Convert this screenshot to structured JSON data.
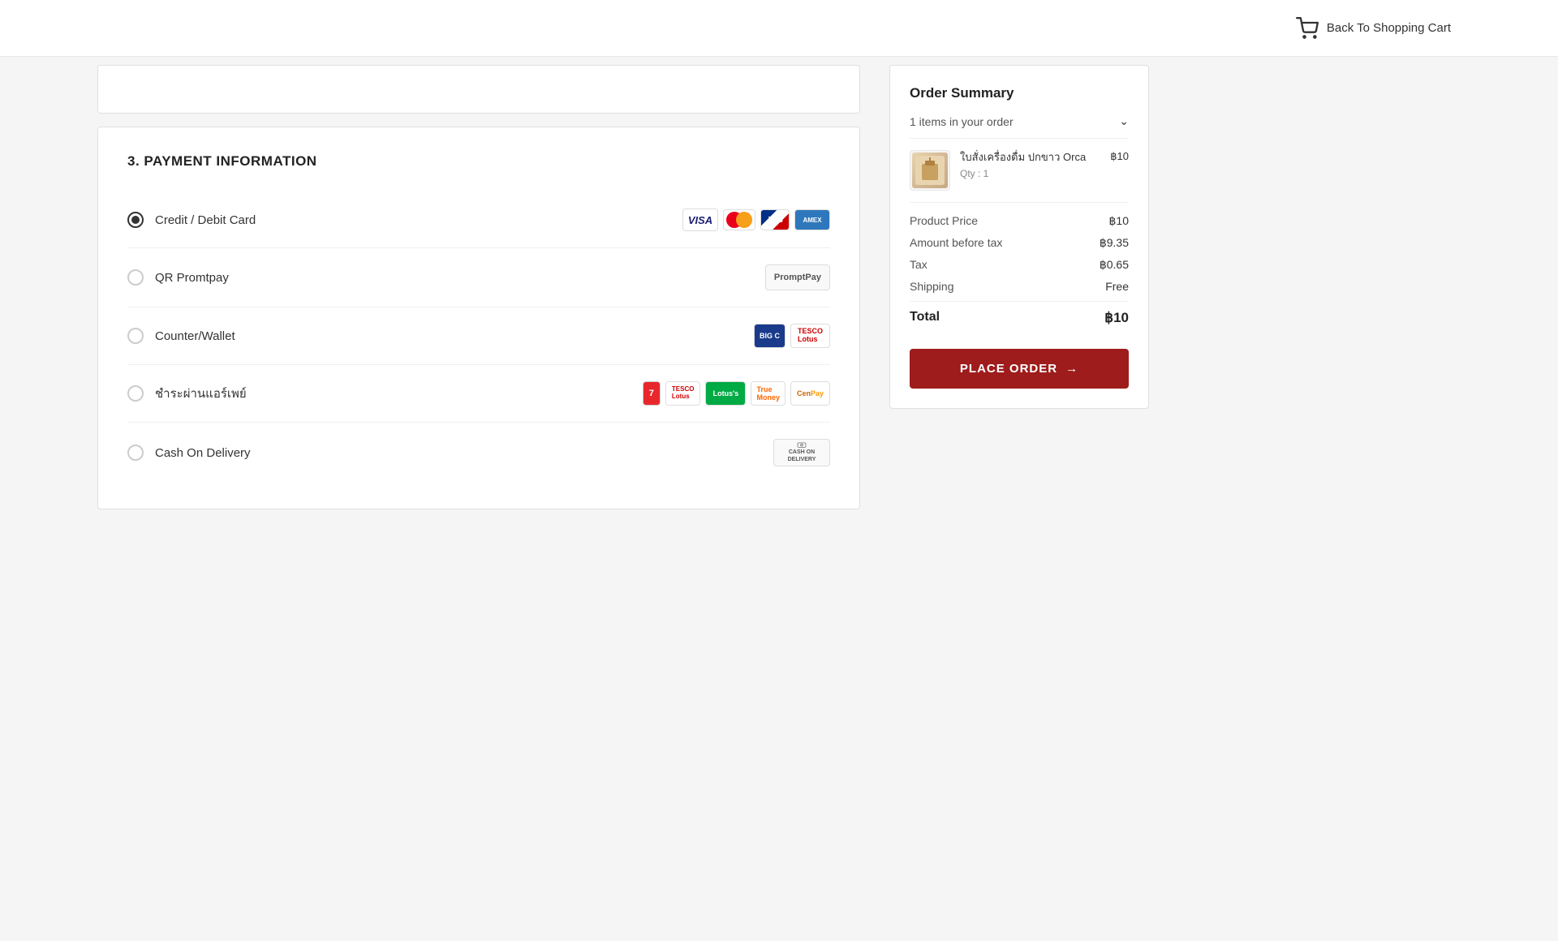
{
  "header": {
    "back_to_cart_label": "Back To Shopping Cart"
  },
  "payment_section": {
    "title": "3. PAYMENT INFORMATION",
    "options": [
      {
        "id": "credit-debit",
        "label": "Credit / Debit Card",
        "selected": true,
        "icons": [
          "visa",
          "mastercard",
          "jcb",
          "amex"
        ]
      },
      {
        "id": "qr-promptpay",
        "label": "QR Promtpay",
        "selected": false,
        "icons": [
          "promptpay"
        ]
      },
      {
        "id": "counter-wallet",
        "label": "Counter/Wallet",
        "selected": false,
        "icons": [
          "bigc",
          "tesco-lotus"
        ]
      },
      {
        "id": "airpay",
        "label": "ชำระผ่านแอร์เพย์",
        "selected": false,
        "icons": [
          "seven",
          "tesco-lotus2",
          "lotus-s",
          "truemoney",
          "cenpay"
        ]
      },
      {
        "id": "cash-delivery",
        "label": "Cash On Delivery",
        "selected": false,
        "icons": [
          "cash-on-delivery"
        ]
      }
    ]
  },
  "order_summary": {
    "title": "Order Summary",
    "items_count_label": "1 items in your order",
    "items_count": 1,
    "product": {
      "name": "ใบสั่งเครื่องดื่ม ปกขาว Orca",
      "qty_label": "Qty : 1",
      "qty": 1,
      "price": "฿10"
    },
    "price_rows": [
      {
        "label": "Product Price",
        "value": "฿10"
      },
      {
        "label": "Amount before tax",
        "value": "฿9.35"
      },
      {
        "label": "Tax",
        "value": "฿0.65"
      },
      {
        "label": "Shipping",
        "value": "Free"
      }
    ],
    "total_label": "Total",
    "total_value": "฿10",
    "place_order_label": "PLACE ORDER",
    "place_order_arrow": "→"
  }
}
